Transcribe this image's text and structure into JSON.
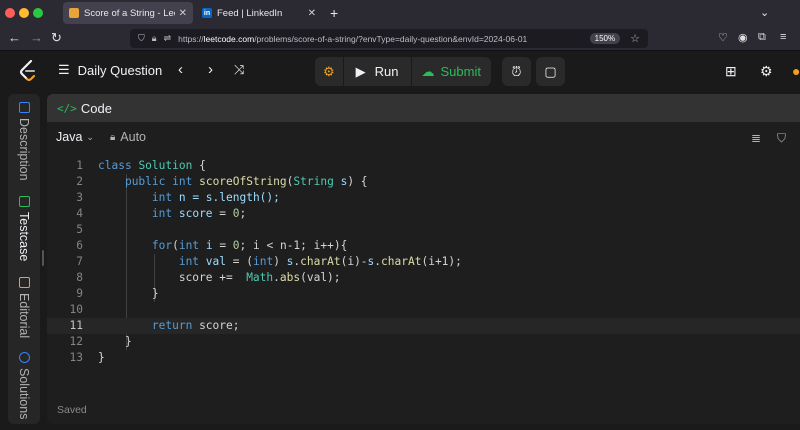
{
  "browser": {
    "tabs": [
      {
        "title": "Score of a String - LeetCode",
        "active": true
      },
      {
        "title": "Feed | LinkedIn",
        "active": false
      }
    ],
    "url_prefix": "https://",
    "url_host": "leetcode.com",
    "url_path": "/problems/score-of-a-string/?envType=daily-question&envId=2024-06-01",
    "zoom": "150%"
  },
  "header": {
    "daily_label": "Daily Question",
    "run_label": "Run",
    "submit_label": "Submit"
  },
  "sidebar": {
    "items": [
      {
        "label": "Description",
        "color": "#3b82f6"
      },
      {
        "label": "Testcase",
        "color": "#2cbb5d"
      },
      {
        "label": "Editorial",
        "color": "#f0a020"
      },
      {
        "label": "Solutions",
        "color": "#3b82f6"
      }
    ]
  },
  "panel": {
    "title": "Code",
    "language": "Java",
    "auto_label": "Auto",
    "status": "Saved",
    "current_line": 11
  },
  "code": {
    "line_numbers": [
      "1",
      "2",
      "3",
      "4",
      "5",
      "6",
      "7",
      "8",
      "9",
      "10",
      "11",
      "12",
      "13"
    ],
    "l1": "Solution",
    "l2_fn": "scoreOfString",
    "l2_type": "String",
    "l3": "n = s.length();",
    "l4_var": "score",
    "l4_num": "0",
    "l6_a": "(",
    "l6_b": "i",
    "l6_c": "0",
    "l6_d": "; i < n-1; i++){",
    "l7_var": "val",
    "l8_fn": "abs",
    "l8_cls": "Math",
    "l11": "score;"
  }
}
